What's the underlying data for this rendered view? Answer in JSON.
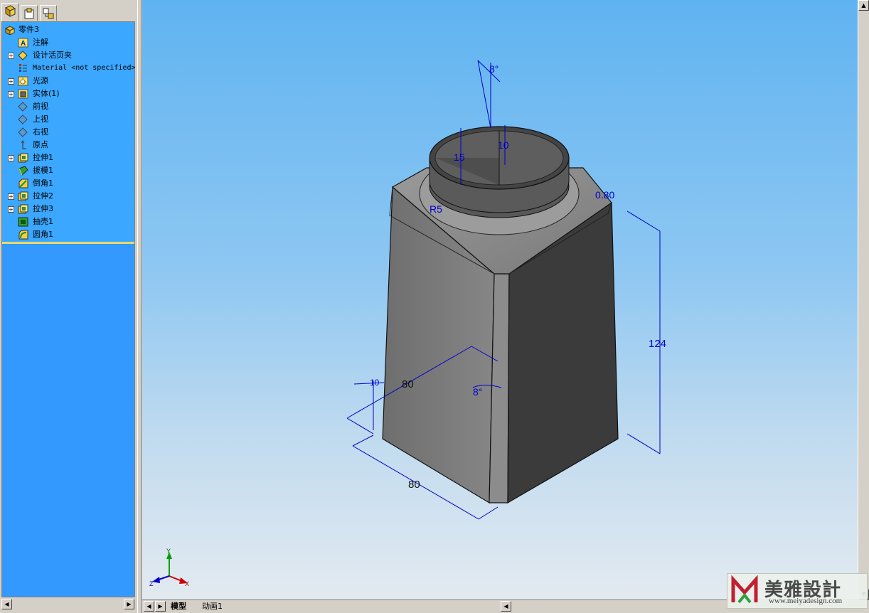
{
  "tree": {
    "root": "零件3",
    "items": [
      {
        "label": "注解",
        "icon": "annotations-icon",
        "expandable": false
      },
      {
        "label": "设计活页夹",
        "icon": "design-binder-icon",
        "expandable": true
      },
      {
        "label": "Material <not specified>",
        "icon": "material-icon",
        "expandable": false
      },
      {
        "label": "光源",
        "icon": "lights-icon",
        "expandable": true
      },
      {
        "label": "实体(1)",
        "icon": "solid-bodies-icon",
        "expandable": true
      },
      {
        "label": "前视",
        "icon": "plane-icon",
        "expandable": false
      },
      {
        "label": "上视",
        "icon": "plane-icon",
        "expandable": false
      },
      {
        "label": "右视",
        "icon": "plane-icon",
        "expandable": false
      },
      {
        "label": "原点",
        "icon": "origin-icon",
        "expandable": false
      },
      {
        "label": "拉伸1",
        "icon": "extrude-icon",
        "expandable": true
      },
      {
        "label": "拔模1",
        "icon": "draft-icon",
        "expandable": false
      },
      {
        "label": "倒角1",
        "icon": "chamfer-icon",
        "expandable": false
      },
      {
        "label": "拉伸2",
        "icon": "extrude-icon",
        "expandable": true
      },
      {
        "label": "拉伸3",
        "icon": "extrude-icon",
        "expandable": true
      },
      {
        "label": "抽壳1",
        "icon": "shell-icon",
        "expandable": false
      },
      {
        "label": "圆角1",
        "icon": "fillet-icon",
        "expandable": false
      }
    ]
  },
  "dimensions": {
    "angle_top": "8°",
    "neck_height": "15",
    "neck_thickness": "10",
    "fillet_radius": "R5",
    "chamfer": "0.80",
    "height": "124",
    "depth": "80",
    "width": "80",
    "offset": "10",
    "draft_angle": "8°"
  },
  "triad": {
    "x": "X",
    "y": "Y",
    "z": "Z"
  },
  "bottom_tabs": [
    {
      "label": "模型",
      "active": true
    },
    {
      "label": "动画1",
      "active": false
    }
  ],
  "watermark": {
    "brand": "美雅設計",
    "url": "www.meiyadesign.com"
  },
  "colors": {
    "tree_bg": "#3ba7ff",
    "dimension_blue": "#0000cc",
    "model_gray": "#7a7a7a"
  }
}
